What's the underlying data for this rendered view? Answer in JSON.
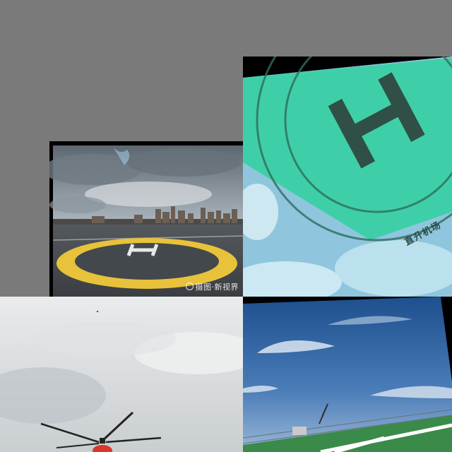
{
  "collage": {
    "tiles": [
      {
        "name": "helipad-rooftop",
        "watermark": "摄图·新视界",
        "helipad_letter": "H"
      },
      {
        "name": "teal-h-sign",
        "helipad_letter": "H",
        "sign_text": "直升机场"
      },
      {
        "name": "red-helicopter"
      },
      {
        "name": "ship-deck"
      }
    ]
  },
  "colors": {
    "background": "#7a7a7a",
    "helipad_ring": "#e8c23a",
    "teal_sign": "#3fcfa8",
    "helicopter": "#d8382b",
    "deck_green": "#3a8a4a",
    "sky_blue": "#2a5fa0"
  }
}
